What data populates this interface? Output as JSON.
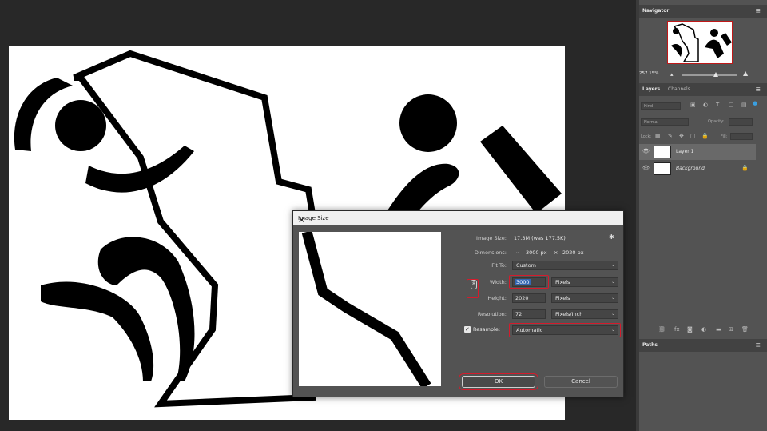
{
  "navigator": {
    "title": "Navigator",
    "zoom": "257.15%"
  },
  "layers_panel": {
    "tabs": [
      "Layers",
      "Channels"
    ],
    "kind_placeholder": "Kind",
    "blend_mode": "Normal",
    "opacity_label": "Opacity:",
    "lock_label": "Lock:",
    "fill_label": "Fill:",
    "layers": [
      {
        "name": "Layer 1",
        "selected": true
      },
      {
        "name": "Background",
        "locked": true
      }
    ]
  },
  "paths_panel": {
    "title": "Paths"
  },
  "dialog": {
    "title": "Image Size",
    "image_size_label": "Image Size:",
    "image_size_value": "17.3M (was 177.5K)",
    "dimensions_label": "Dimensions:",
    "dim_width": "3000 px",
    "dim_x": "×",
    "dim_height": "2020 px",
    "fit_to_label": "Fit To:",
    "fit_to_value": "Custom",
    "width_label": "Width:",
    "width_value": "3000",
    "width_unit": "Pixels",
    "height_label": "Height:",
    "height_value": "2020",
    "height_unit": "Pixels",
    "resolution_label": "Resolution:",
    "resolution_value": "72",
    "resolution_unit": "Pixels/Inch",
    "resample_label": "Resample:",
    "resample_checked": true,
    "resample_value": "Automatic",
    "ok_label": "OK",
    "cancel_label": "Cancel"
  },
  "icons": {
    "close": "close-icon",
    "gear": "gear-icon",
    "link": "link-icon",
    "eye": "eye-icon",
    "lock": "lock-icon",
    "menu": "panel-menu-icon"
  },
  "colors": {
    "highlight": "#d41b2c",
    "selection": "#3367b2",
    "panel": "#535353",
    "workspace": "#282828"
  }
}
